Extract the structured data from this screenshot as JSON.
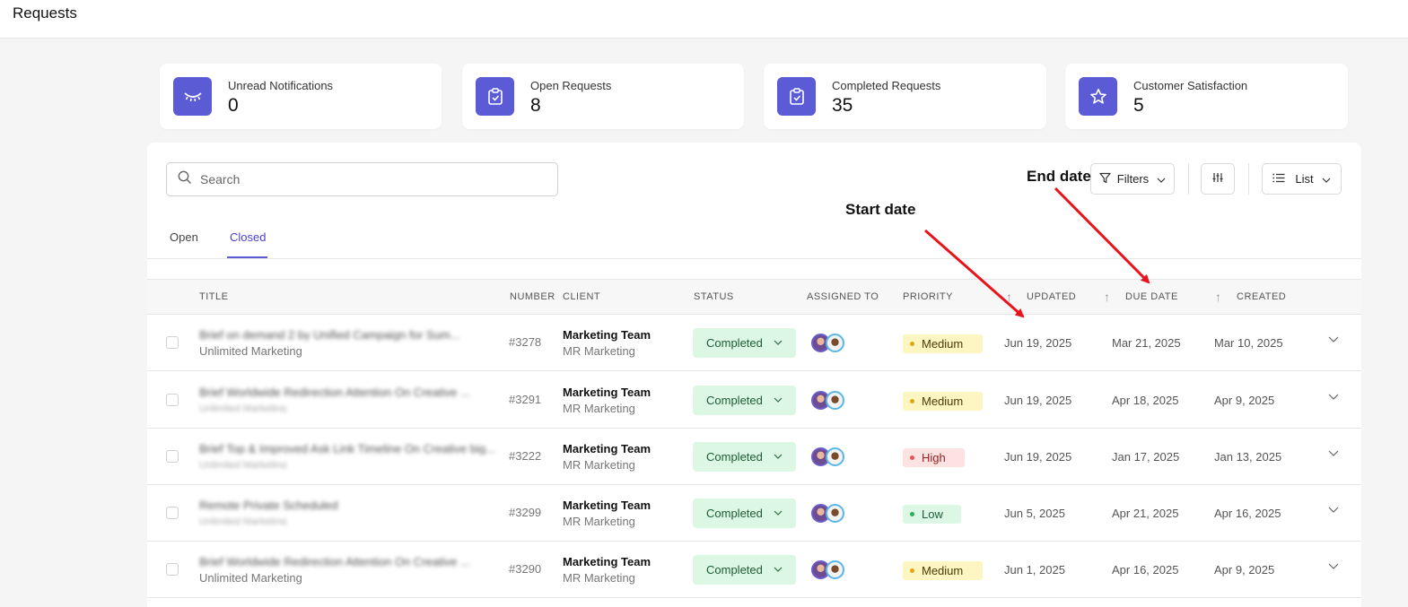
{
  "header": {
    "title": "Requests"
  },
  "stats": [
    {
      "label": "Unread Notifications",
      "value": "0",
      "icon": "eye-closed-icon"
    },
    {
      "label": "Open Requests",
      "value": "8",
      "icon": "clipboard-check-icon"
    },
    {
      "label": "Completed Requests",
      "value": "35",
      "icon": "clipboard-check-icon"
    },
    {
      "label": "Customer Satisfaction",
      "value": "5",
      "icon": "star-icon"
    }
  ],
  "search": {
    "placeholder": "Search",
    "value": ""
  },
  "toolbar": {
    "filters_label": "Filters",
    "view_label": "List"
  },
  "tabs": [
    {
      "label": "Open"
    },
    {
      "label": "Closed",
      "active": true
    }
  ],
  "table": {
    "columns": {
      "title": "TITLE",
      "number": "NUMBER",
      "client": "CLIENT",
      "status": "STATUS",
      "assigned": "ASSIGNED TO",
      "priority": "PRIORITY",
      "updated": "UPDATED",
      "due": "DUE DATE",
      "created": "CREATED"
    },
    "rows": [
      {
        "title_blurred": "Brief on demand 2 by Unified Campaign for Sum...",
        "subtitle": "Unlimited Marketing",
        "subtitle_blurred": false,
        "number": "#3278",
        "client": "Marketing Team",
        "client_sub": "MR Marketing",
        "status": "Completed",
        "priority": "Medium",
        "updated": "Jun 19, 2025",
        "due": "Mar 21, 2025",
        "created": "Mar 10, 2025"
      },
      {
        "title_blurred": "Brief Worldwide Redirection Attention On Creative ...",
        "subtitle": "Unlimited Marketing",
        "subtitle_blurred": true,
        "number": "#3291",
        "client": "Marketing Team",
        "client_sub": "MR Marketing",
        "status": "Completed",
        "priority": "Medium",
        "updated": "Jun 19, 2025",
        "due": "Apr 18, 2025",
        "created": "Apr 9, 2025"
      },
      {
        "title_blurred": "Brief Top & Improved Ask Link Timeline On Creative big...",
        "subtitle": "Unlimited Marketing",
        "subtitle_blurred": true,
        "number": "#3222",
        "client": "Marketing Team",
        "client_sub": "MR Marketing",
        "status": "Completed",
        "priority": "High",
        "updated": "Jun 19, 2025",
        "due": "Jan 17, 2025",
        "created": "Jan 13, 2025"
      },
      {
        "title_blurred": "Remote Private Scheduled",
        "subtitle": "Unlimited Marketing",
        "subtitle_blurred": true,
        "short": true,
        "number": "#3299",
        "client": "Marketing Team",
        "client_sub": "MR Marketing",
        "status": "Completed",
        "priority": "Low",
        "updated": "Jun 5, 2025",
        "due": "Apr 21, 2025",
        "created": "Apr 16, 2025"
      },
      {
        "title_blurred": "Brief Worldwide Redirection Attention On Creative ...",
        "subtitle": "Unlimited Marketing",
        "subtitle_blurred": false,
        "number": "#3290",
        "client": "Marketing Team",
        "client_sub": "MR Marketing",
        "status": "Completed",
        "priority": "Medium",
        "updated": "Jun 1, 2025",
        "due": "Apr 16, 2025",
        "created": "Apr 9, 2025"
      }
    ]
  },
  "annotations": {
    "start_date": "Start date",
    "end_date": "End date",
    "arrow_color": "#e8131b"
  },
  "colors": {
    "accent": "#5b5bd6"
  }
}
